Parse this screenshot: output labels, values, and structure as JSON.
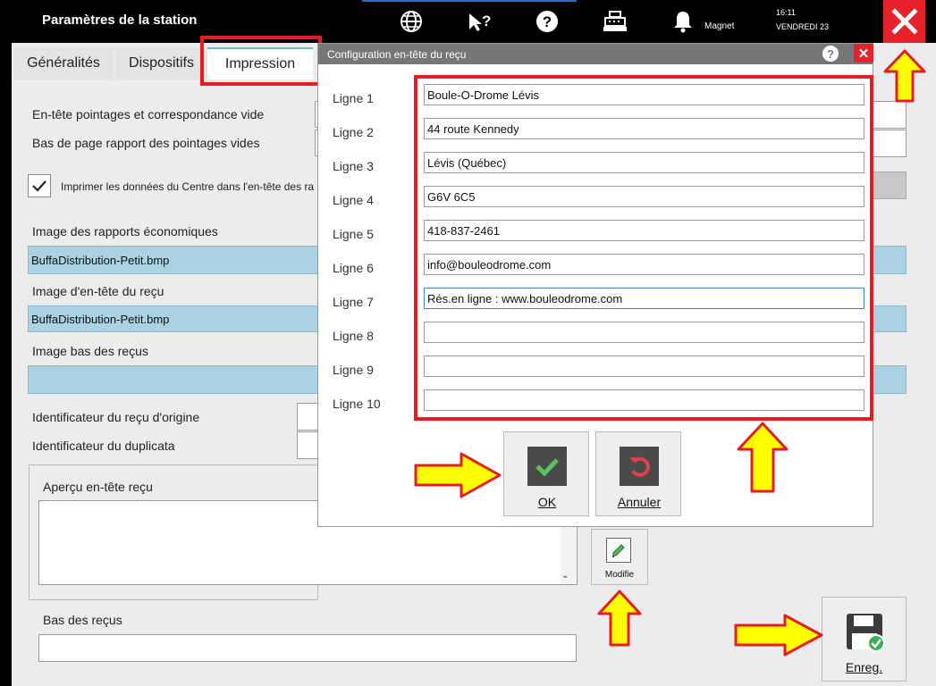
{
  "app": {
    "title": "Paramètres de la station",
    "user": "Magnet",
    "time": "16:11",
    "date": "VENDREDI 23"
  },
  "tabs": [
    {
      "label": "Généralités"
    },
    {
      "label": "Dispositifs"
    },
    {
      "label": "Impression"
    }
  ],
  "form": {
    "header_empty_label": "En-tête pointages et correspondance vide",
    "footer_empty_label": "Bas de page rapport des pointages vides",
    "print_center_label": "Imprimer les données du Centre dans l'en-tête des ra",
    "print_center_checked": true,
    "econ_image_label": "Image des rapports économiques",
    "econ_image_value": "BuffaDistribution-Petit.bmp",
    "receipt_header_image_label": "Image d'en-tête du reçu",
    "receipt_header_image_value": "BuffaDistribution-Petit.bmp",
    "receipt_footer_image_label": "Image bas des reçus",
    "orig_receipt_id_label": "Identificateur du reçu d'origine",
    "duplicate_id_label": "Identificateur du duplicata",
    "preview_label": "Aperçu en-tête reçu",
    "modify_label": "Modifie",
    "footer_label": "Bas des reçus",
    "save_label": "Enreg."
  },
  "dialog": {
    "title": "Configuration en-tête du reçu",
    "help": "?",
    "lines": [
      {
        "label": "Ligne 1",
        "value": "Boule-O-Drome Lévis"
      },
      {
        "label": "Ligne 2",
        "value": "44 route Kennedy"
      },
      {
        "label": "Ligne 3",
        "value": "Lévis (Québec)"
      },
      {
        "label": "Ligne 4",
        "value": "G6V 6C5"
      },
      {
        "label": "Ligne 5",
        "value": "418-837-2461"
      },
      {
        "label": "Ligne 6",
        "value": "info@bouleodrome.com"
      },
      {
        "label": "Ligne 7",
        "value": "Rés.en ligne : www.bouleodrome.com"
      },
      {
        "label": "Ligne 8",
        "value": ""
      },
      {
        "label": "Ligne 9",
        "value": ""
      },
      {
        "label": "Ligne 10",
        "value": ""
      }
    ],
    "ok_label": "OK",
    "cancel_label": "Annuler"
  },
  "colors": {
    "accent_red": "#e8202a",
    "highlight_blue": "#a9d3e3",
    "arrow_yellow": "#ffff00"
  }
}
